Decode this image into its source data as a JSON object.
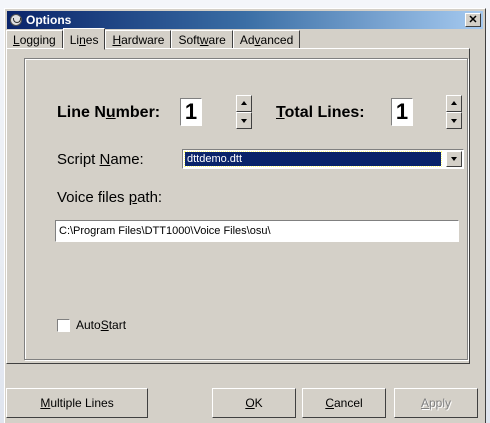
{
  "window": {
    "title": "Options",
    "close_glyph": "✕"
  },
  "tabs": [
    {
      "pre": "",
      "u": "L",
      "post": "ogging"
    },
    {
      "pre": "Li",
      "u": "n",
      "post": "es"
    },
    {
      "pre": "",
      "u": "H",
      "post": "ardware"
    },
    {
      "pre": "Soft",
      "u": "w",
      "post": "are"
    },
    {
      "pre": "Ad",
      "u": "v",
      "post": "anced"
    }
  ],
  "lines": {
    "line_number_label_pre": "Line N",
    "line_number_label_u": "u",
    "line_number_label_post": "mber:",
    "line_number_value": "1",
    "total_lines_label_pre": "",
    "total_lines_label_u": "T",
    "total_lines_label_post": "otal Lines:",
    "total_lines_value": "1",
    "script_name_label_pre": "Script ",
    "script_name_label_u": "N",
    "script_name_label_post": "ame:",
    "script_name_value": "dttdemo.dtt",
    "voice_path_label_pre": "Voice files ",
    "voice_path_label_u": "p",
    "voice_path_label_post": "ath:",
    "voice_path_value": "C:\\Program Files\\DTT1000\\Voice Files\\osu\\",
    "autostart_label_pre": "Auto",
    "autostart_label_u": "S",
    "autostart_label_post": "tart",
    "autostart_checked": false
  },
  "buttons": {
    "multiple_lines_u": "M",
    "multiple_lines_post": "ultiple Lines",
    "ok_u": "O",
    "ok_post": "K",
    "cancel_u": "C",
    "cancel_post": "ancel",
    "apply_u": "A",
    "apply_post": "pply"
  }
}
